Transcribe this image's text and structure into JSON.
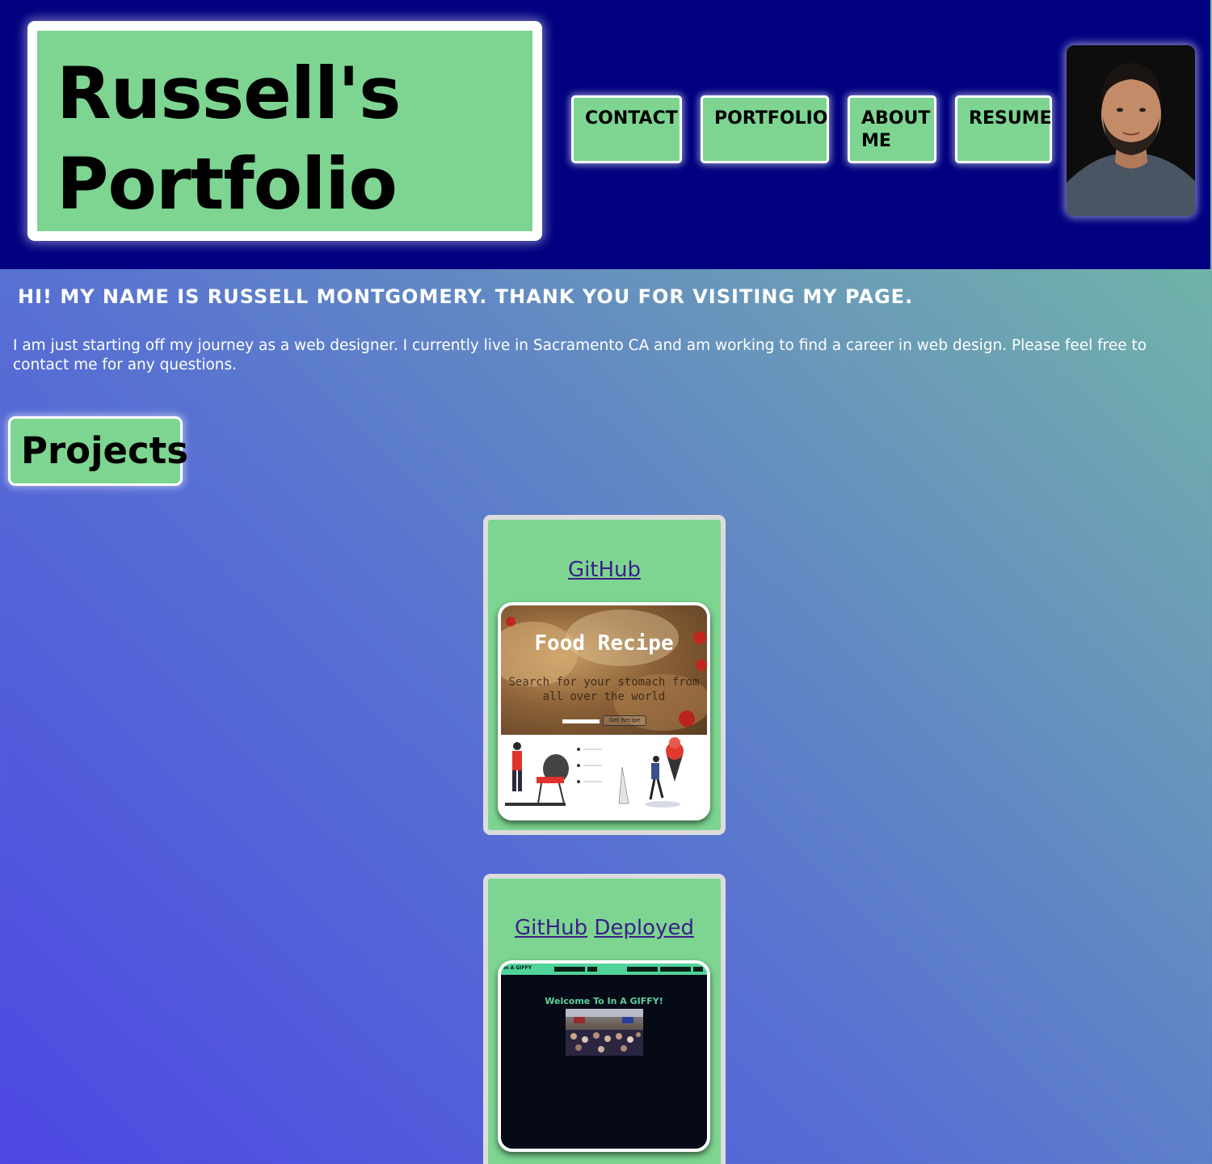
{
  "header": {
    "title": "Russell's Portfolio",
    "nav": {
      "contact": "CONTACT",
      "portfolio": "PORTFOLIO",
      "about": "ABOUT ME",
      "resume": "RESUME"
    },
    "avatar_icon": "profile-photo"
  },
  "intro": {
    "greeting": "HI! MY NAME IS RUSSELL MONTGOMERY. THANK YOU FOR VISITING MY PAGE.",
    "paragraph": "I am just starting off my journey as a web designer. I currently live in Sacramento CA and am working to find a career in web design. Please feel free to contact me for any questions."
  },
  "projects": {
    "heading": "Projects",
    "cards": [
      {
        "links": [
          "GitHub"
        ],
        "screenshot": {
          "title": "Food Recipe",
          "subtitle": "Search for your stomach from all over the world",
          "button": "Get Recipe"
        }
      },
      {
        "links": [
          "GitHub",
          "Deployed"
        ],
        "screenshot": {
          "brand": "In A GIFFY",
          "welcome": "Welcome To In A GIFFY!"
        }
      }
    ]
  },
  "colors": {
    "header_bg": "#000080",
    "accent_green": "#7dd591",
    "link": "#3b1f8a",
    "gradient_start": "#4d47e3",
    "gradient_end": "#74c3a0"
  }
}
